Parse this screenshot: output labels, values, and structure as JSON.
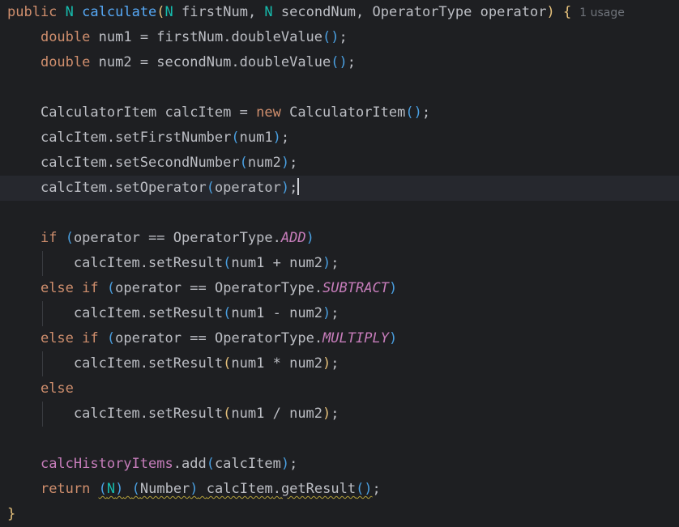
{
  "usage_hint": "1 usage",
  "tokens": {
    "public": "public",
    "N": "N",
    "calculate": "calculate",
    "firstNum": "firstNum",
    "secondNum": "secondNum",
    "OperatorType": "OperatorType",
    "operator": "operator",
    "double": "double",
    "num1": "num1",
    "num2": "num2",
    "doubleValue": "doubleValue",
    "CalculatorItem": "CalculatorItem",
    "calcItem": "calcItem",
    "new": "new",
    "setFirstNumber": "setFirstNumber",
    "setSecondNumber": "setSecondNumber",
    "setOperator": "setOperator",
    "if": "if",
    "else": "else",
    "ADD": "ADD",
    "SUBTRACT": "SUBTRACT",
    "MULTIPLY": "MULTIPLY",
    "setResult": "setResult",
    "calcHistoryItems": "calcHistoryItems",
    "add": "add",
    "return": "return",
    "Number": "Number",
    "getResult": "getResult"
  }
}
